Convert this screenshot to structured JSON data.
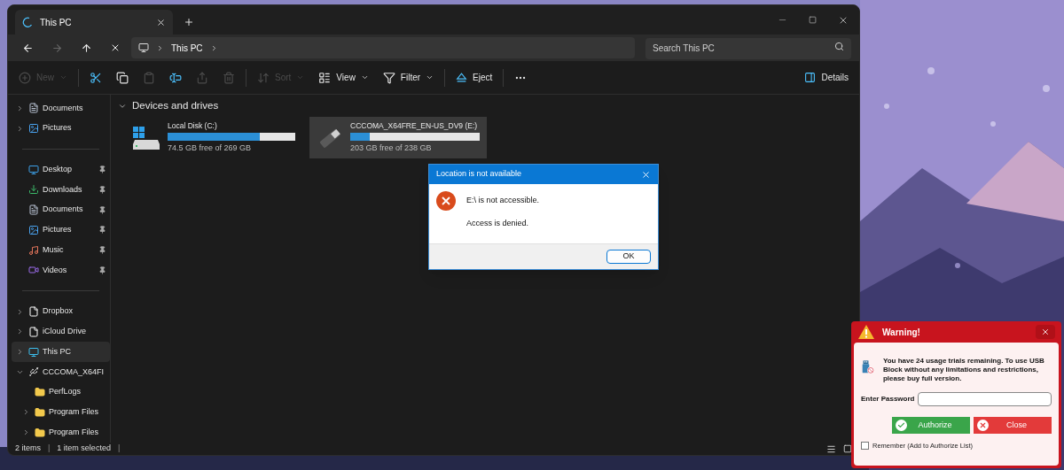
{
  "explorer": {
    "tab": {
      "title": "This PC",
      "loading": true
    },
    "nav": {
      "back_disabled": false,
      "forward_disabled": true,
      "path": [
        "This PC"
      ],
      "search_placeholder": "Search This PC"
    },
    "toolbar": [
      {
        "kind": "new",
        "label": "New",
        "dropdown": true,
        "disabled": true
      },
      {
        "kind": "cut",
        "disabled": false
      },
      {
        "kind": "copy",
        "disabled": false
      },
      {
        "kind": "paste",
        "disabled": true
      },
      {
        "kind": "rename",
        "disabled": false
      },
      {
        "kind": "share",
        "disabled": true
      },
      {
        "kind": "delete",
        "disabled": true
      },
      {
        "kind": "sort",
        "label": "Sort",
        "dropdown": true,
        "disabled": true
      },
      {
        "kind": "view",
        "label": "View",
        "dropdown": true,
        "disabled": false
      },
      {
        "kind": "filter",
        "label": "Filter",
        "dropdown": true,
        "disabled": false
      },
      {
        "kind": "eject",
        "label": "Eject",
        "dropdown": false,
        "disabled": false
      },
      {
        "kind": "more",
        "disabled": false
      }
    ],
    "details_label": "Details",
    "sidebar": [
      [
        {
          "kind": "documents",
          "label": "Documents",
          "expandable": true,
          "expanded": false,
          "pinned": false,
          "selected": false
        },
        {
          "kind": "pictures",
          "label": "Pictures",
          "expandable": true,
          "expanded": false,
          "pinned": false,
          "selected": false
        }
      ],
      [
        {
          "kind": "desktop",
          "label": "Desktop",
          "expandable": false,
          "pinned": true,
          "selected": false
        },
        {
          "kind": "downloads",
          "label": "Downloads",
          "expandable": false,
          "pinned": true,
          "selected": false
        },
        {
          "kind": "documents",
          "label": "Documents",
          "expandable": false,
          "pinned": true,
          "selected": false
        },
        {
          "kind": "pictures",
          "label": "Pictures",
          "expandable": false,
          "pinned": true,
          "selected": false
        },
        {
          "kind": "music",
          "label": "Music",
          "expandable": false,
          "pinned": true,
          "selected": false
        },
        {
          "kind": "videos",
          "label": "Videos",
          "expandable": false,
          "pinned": true,
          "selected": false
        }
      ],
      [
        {
          "kind": "file",
          "label": "Dropbox",
          "expandable": true,
          "expanded": false,
          "pinned": false,
          "selected": false
        },
        {
          "kind": "file",
          "label": "iCloud Drive",
          "expandable": true,
          "expanded": false,
          "pinned": false,
          "selected": false
        },
        {
          "kind": "pc",
          "label": "This PC",
          "expandable": true,
          "expanded": false,
          "pinned": false,
          "selected": true
        },
        {
          "kind": "usb",
          "label": "CCCOMA_X64FI",
          "expandable": true,
          "expanded": true,
          "pinned": false,
          "selected": false,
          "children": [
            {
              "kind": "folder",
              "label": "PerfLogs",
              "expandable": false,
              "pinned": false,
              "selected": false
            },
            {
              "kind": "folder",
              "label": "Program Files",
              "expandable": true,
              "expanded": false,
              "pinned": false,
              "selected": false
            },
            {
              "kind": "folder",
              "label": "Program Files",
              "expandable": true,
              "expanded": false,
              "pinned": false,
              "selected": false
            }
          ]
        }
      ]
    ],
    "section_title": "Devices and drives",
    "drives": [
      {
        "kind": "disk",
        "name": "Local Disk (C:)",
        "free": "74.5 GB free of 269 GB",
        "level": 0.72,
        "selected": false
      },
      {
        "kind": "usb",
        "name": "CCCOMA_X64FRE_EN-US_DV9 (E:)",
        "free": "203 GB free of 238 GB",
        "level": 0.15,
        "selected": true
      }
    ],
    "status": [
      {
        "kind": "text",
        "text": "2 items"
      },
      {
        "kind": "separator",
        "text": "|"
      },
      {
        "kind": "text",
        "text": "1 item selected"
      },
      {
        "kind": "separator",
        "text": "|"
      }
    ]
  },
  "dialog": {
    "title": "Location is not available",
    "lines": [
      "E:\\ is not accessible.",
      "Access is denied."
    ],
    "button": "OK"
  },
  "warning": {
    "title": "Warning!",
    "message": "You have 24 usage trials remaining. To use USB Block without any limitations and restrictions, please buy full version.",
    "password_label": "Enter Password",
    "buttons": [
      {
        "kind": "authorize",
        "label": "Authorize"
      },
      {
        "kind": "close",
        "label": "Close"
      }
    ],
    "remember": {
      "label": "Remember (Add to Authorize List)",
      "checked": false
    }
  }
}
